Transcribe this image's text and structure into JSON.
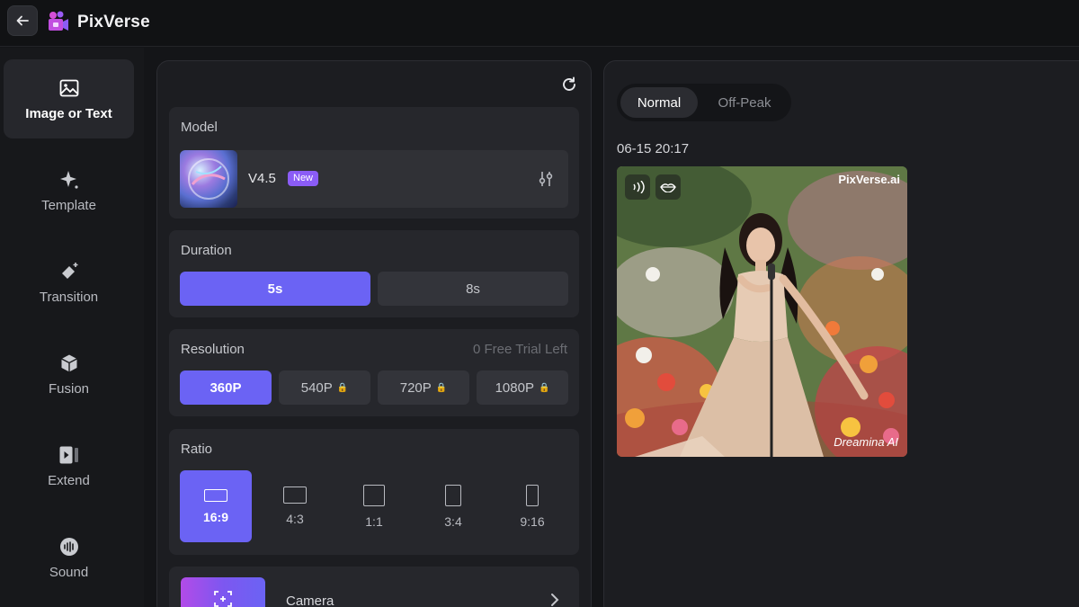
{
  "app": {
    "name": "PixVerse"
  },
  "sidebar": {
    "items": [
      {
        "label": "Image or Text",
        "icon": "image-icon",
        "active": true
      },
      {
        "label": "Template",
        "icon": "sparkle-icon",
        "active": false
      },
      {
        "label": "Transition",
        "icon": "transition-icon",
        "active": false
      },
      {
        "label": "Fusion",
        "icon": "cube-icon",
        "active": false
      },
      {
        "label": "Extend",
        "icon": "extend-icon",
        "active": false
      },
      {
        "label": "Sound",
        "icon": "sound-wave-icon",
        "active": false
      }
    ]
  },
  "model": {
    "label": "Model",
    "name": "V4.5",
    "badge": "New"
  },
  "duration": {
    "label": "Duration",
    "options": [
      "5s",
      "8s"
    ],
    "selected": "5s"
  },
  "resolution": {
    "label": "Resolution",
    "trial_text": "0 Free Trial Left",
    "options": [
      "360P",
      "540P",
      "720P",
      "1080P"
    ],
    "selected": "360P"
  },
  "ratio": {
    "label": "Ratio",
    "options": [
      "16:9",
      "4:3",
      "1:1",
      "3:4",
      "9:16"
    ],
    "selected": "16:9"
  },
  "camera": {
    "label": "Camera"
  },
  "queue": {
    "modes": [
      "Normal",
      "Off-Peak"
    ],
    "selected": "Normal"
  },
  "result": {
    "timestamp": "06-15 20:17",
    "watermark_top": "PixVerse.ai",
    "watermark_bottom": "Dreamina AI"
  },
  "colors": {
    "accent": "#6b63f4",
    "badge": "#8b5cf6",
    "background": "#141518"
  }
}
